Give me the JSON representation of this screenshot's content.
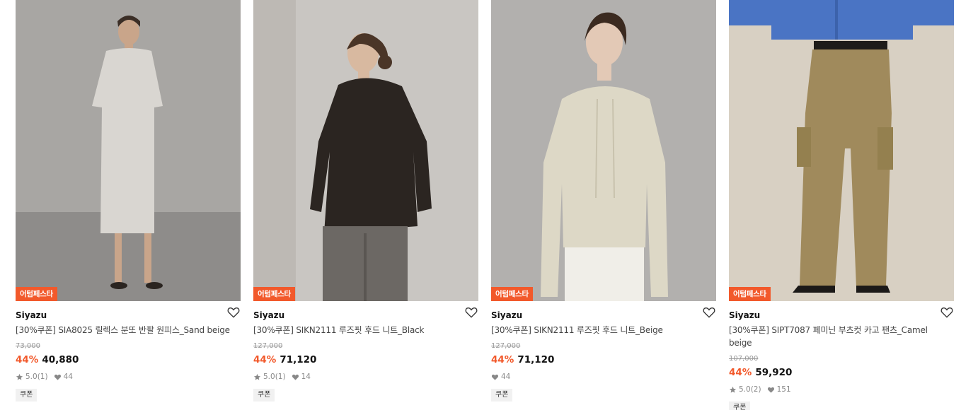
{
  "products": [
    {
      "event_badge": "어텀페스타",
      "brand": "Siyazu",
      "title": "[30%쿠폰] SIA8025 릴렉스 분또 반팔 원피스_Sand beige",
      "original_price": "73,000",
      "discount": "44%",
      "price": "40,880",
      "rating": "5.0",
      "review_count": "(1)",
      "likes": "44",
      "coupon_label": "쿠폰",
      "image_desc": "model-in-sand-beige-dress"
    },
    {
      "event_badge": "어텀페스타",
      "brand": "Siyazu",
      "title": "[30%쿠폰] SIKN2111 루즈핏 후드 니트_Black",
      "original_price": "127,000",
      "discount": "44%",
      "price": "71,120",
      "rating": "5.0",
      "review_count": "(1)",
      "likes": "14",
      "coupon_label": "쿠폰",
      "image_desc": "model-in-black-hood-knit"
    },
    {
      "event_badge": "어텀페스타",
      "brand": "Siyazu",
      "title": "[30%쿠폰] SIKN2111 루즈핏 후드 니트_Beige",
      "original_price": "127,000",
      "discount": "44%",
      "price": "71,120",
      "likes": "44",
      "coupon_label": "쿠폰",
      "image_desc": "model-in-beige-hood-knit"
    },
    {
      "event_badge": "어텀페스타",
      "brand": "Siyazu",
      "title": "[30%쿠폰] SIPT7087 페미닌 부츠컷 카고 팬츠_Camel beige",
      "original_price": "107,000",
      "discount": "44%",
      "price": "59,920",
      "rating": "5.0",
      "review_count": "(2)",
      "likes": "151",
      "coupon_label": "쿠폰",
      "image_desc": "model-in-camel-cargo-pants"
    }
  ],
  "colors": {
    "accent": "#f2592b",
    "event_badge_bg": "#f2592b"
  },
  "icons": {
    "wishlist": "heart-outline-icon",
    "rating": "star-icon",
    "likes": "heart-filled-icon"
  }
}
